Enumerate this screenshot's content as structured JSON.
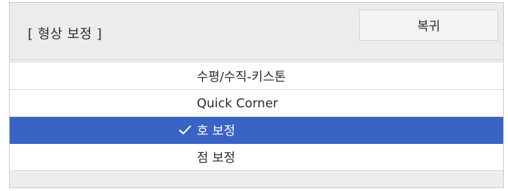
{
  "dialog": {
    "title": "[ 형상 보정 ]",
    "reset_label": "복귀"
  },
  "menu": {
    "items": [
      {
        "label": "수평/수직-키스톤",
        "selected": false
      },
      {
        "label": "Quick Corner",
        "selected": false
      },
      {
        "label": "호 보정",
        "selected": true
      },
      {
        "label": "점 보정",
        "selected": false
      }
    ]
  },
  "colors": {
    "panel_background": "#ededed",
    "selection": "#3a63c6",
    "item_background": "#ffffff"
  },
  "icons": {
    "selected_marker": "checkmark-icon"
  }
}
